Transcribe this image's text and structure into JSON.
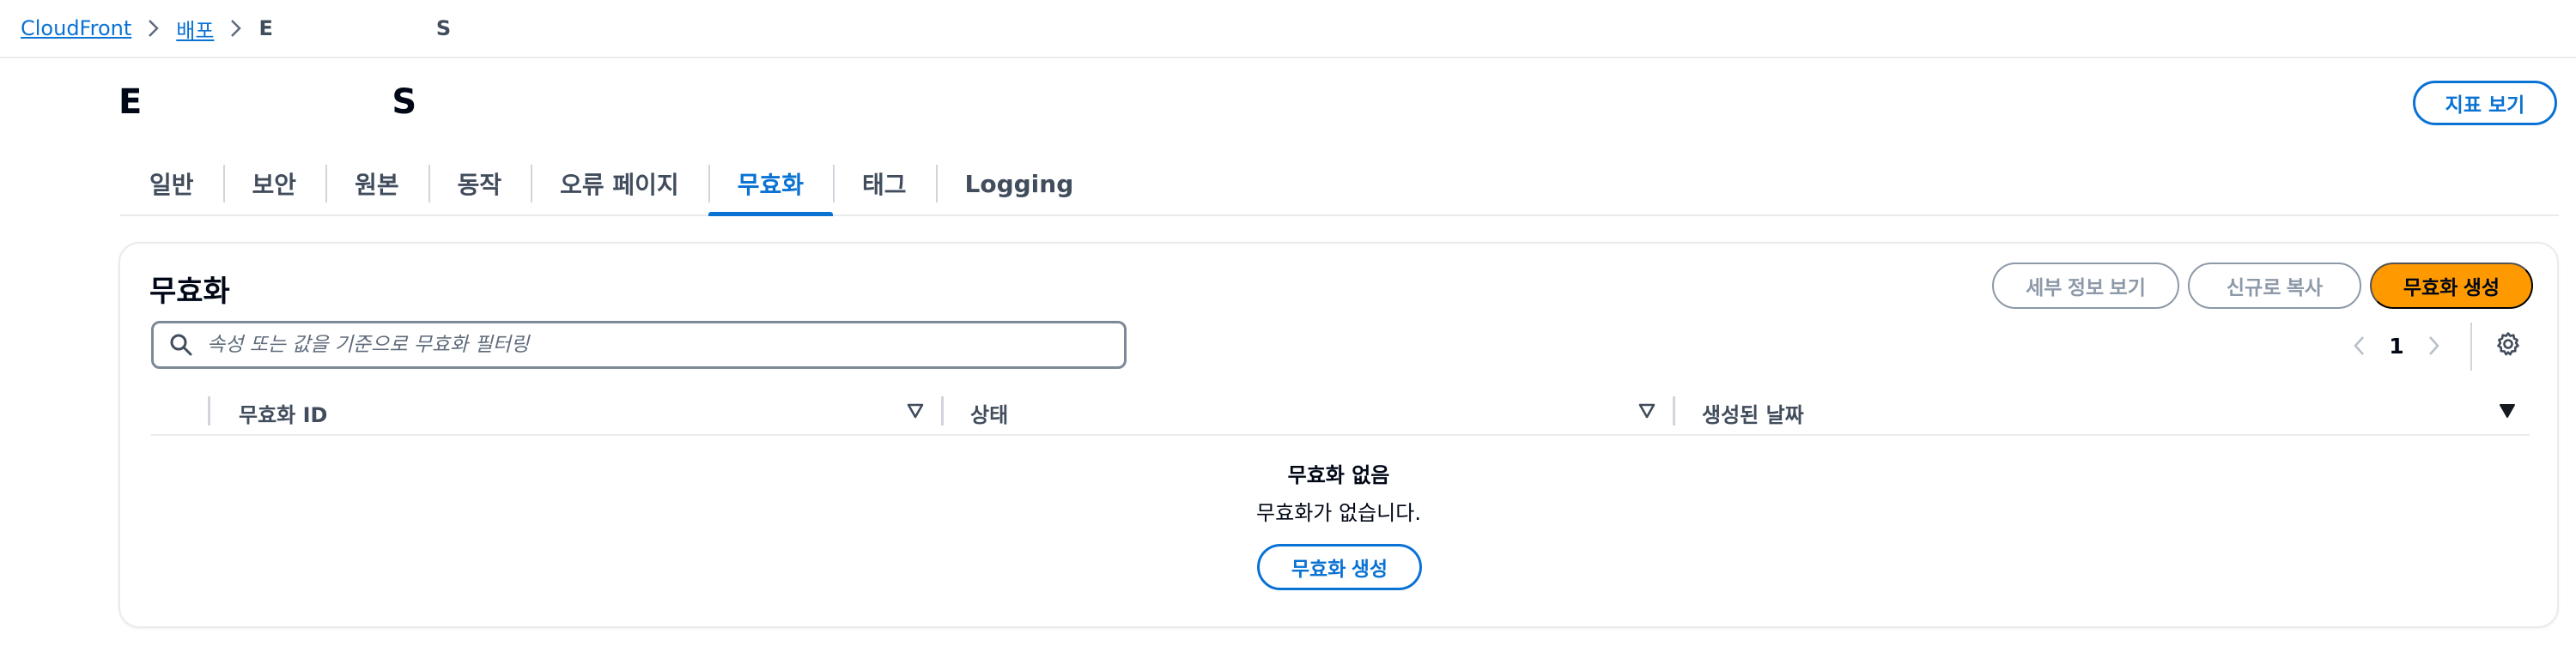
{
  "breadcrumb": {
    "service": "CloudFront",
    "distributions": "배포",
    "current_prefix": "E",
    "current_suffix": "S"
  },
  "header": {
    "title_prefix": "E",
    "title_suffix": "S",
    "metrics_button": "지표 보기"
  },
  "tabs": [
    {
      "label": "일반"
    },
    {
      "label": "보안"
    },
    {
      "label": "원본"
    },
    {
      "label": "동작"
    },
    {
      "label": "오류 페이지"
    },
    {
      "label": "무효화"
    },
    {
      "label": "태그"
    },
    {
      "label": "Logging"
    }
  ],
  "active_tab": "무효화",
  "invalidations": {
    "title": "무효화",
    "details_button": "세부 정보 보기",
    "copy_button": "신규로 복사",
    "create_button": "무효화 생성",
    "search": {
      "placeholder": "속성 또는 값을 기준으로 무효화 필터링",
      "value": ""
    },
    "pagination": {
      "current_page": "1"
    },
    "columns": [
      {
        "label": "무효화 ID"
      },
      {
        "label": "상태"
      },
      {
        "label": "생성된 날짜"
      }
    ],
    "empty": {
      "title": "무효화 없음",
      "description": "무효화가 없습니다.",
      "button": "무효화 생성"
    }
  },
  "colors": {
    "link": "#0972d3",
    "primary_button": "#ff9900",
    "disabled": "#8d99a8",
    "text": "#000716"
  }
}
